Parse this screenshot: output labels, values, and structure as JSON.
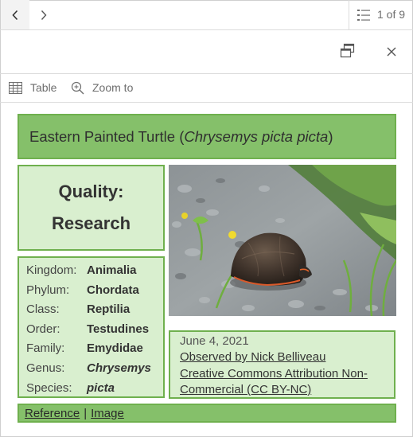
{
  "nav": {
    "page_count": "1 of 9",
    "back_icon": "chevron-left-icon",
    "forward_icon": "chevron-right-icon",
    "list_icon": "list-icon"
  },
  "actions": {
    "dock_icon": "dock-icon",
    "close_icon": "close-icon"
  },
  "toolbar": {
    "table_label": "Table",
    "zoom_label": "Zoom to",
    "table_icon": "table-icon",
    "zoom_icon": "zoom-in-icon"
  },
  "popup": {
    "title_common": "Eastern Painted Turtle (",
    "title_scientific": "Chrysemys picta picta",
    "title_close": ")",
    "quality_line1": "Quality:",
    "quality_line2": "Research",
    "taxonomy": [
      {
        "rank": "Kingdom:",
        "value": "Animalia"
      },
      {
        "rank": "Phylum:",
        "value": "Chordata"
      },
      {
        "rank": "Class:",
        "value": "Reptilia"
      },
      {
        "rank": "Order:",
        "value": "Testudines"
      },
      {
        "rank": "Family:",
        "value": "Emydidae"
      },
      {
        "rank": "Genus:",
        "value": "Chrysemys"
      },
      {
        "rank": "Species:",
        "value": "picta"
      }
    ],
    "date": "June 4, 2021",
    "observer": "Observed by Nick Belliveau",
    "license_line1": "Creative Commons Attribution Non-",
    "license_line2": "Commercial (CC BY-NC)",
    "reference_link": "Reference",
    "link_separator": "|",
    "image_link": "Image"
  },
  "colors": {
    "header_green": "#85c06a",
    "panel_green": "#d9efcf",
    "border_green": "#6fb04e"
  }
}
